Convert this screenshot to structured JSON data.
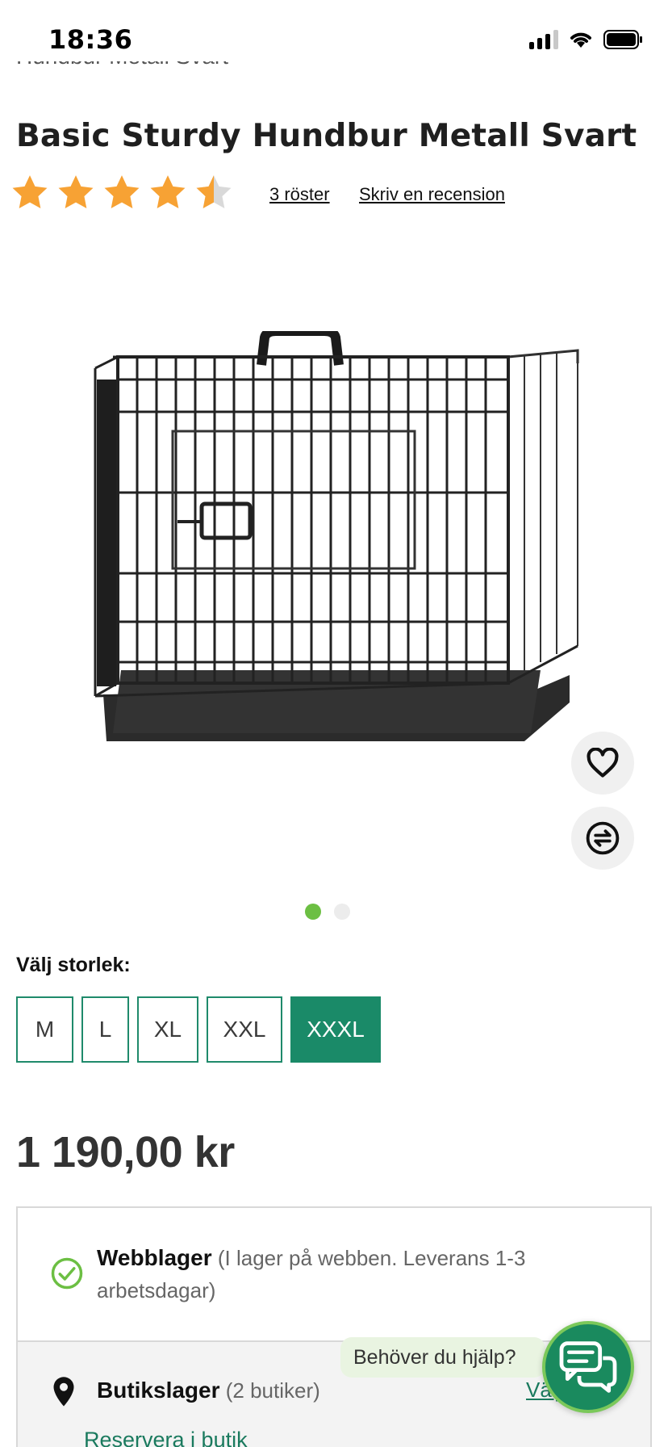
{
  "status_bar": {
    "time": "18:36",
    "icons": [
      "cellular-signal-icon",
      "wifi-icon",
      "battery-icon"
    ]
  },
  "breadcrumb": "Hundbur Metall Svart",
  "product": {
    "title": "Basic Sturdy Hundbur Metall Svart",
    "rating_value": 4.5,
    "rating_max": 5,
    "votes_link": "3 röster",
    "review_link": "Skriv en recension",
    "image_icon": "dog-crate-image"
  },
  "actions": {
    "favorite_icon": "heart-icon",
    "compare_icon": "compare-arrows-icon"
  },
  "carousel": {
    "count": 2,
    "active_index": 0
  },
  "size": {
    "label": "Välj storlek:",
    "options": [
      "M",
      "L",
      "XL",
      "XXL",
      "XXXL"
    ],
    "selected": "XXXL"
  },
  "price": "1 190,00 kr",
  "stock": {
    "web_title": "Webblager",
    "web_detail": "(I lager på webben. Leverans 1-3 arbetsdagar)",
    "store_title": "Butikslager",
    "store_detail": "(2 butiker)",
    "choose_link": "Välj",
    "reserve_link": "Reservera i butik"
  },
  "help": {
    "bubble_text": "Behöver du hjälp?",
    "chat_icon": "chat-bubbles-icon"
  },
  "colors": {
    "brand_green": "#1a8a68",
    "star_orange": "#f7a234",
    "dot_active": "#6cbf43"
  }
}
